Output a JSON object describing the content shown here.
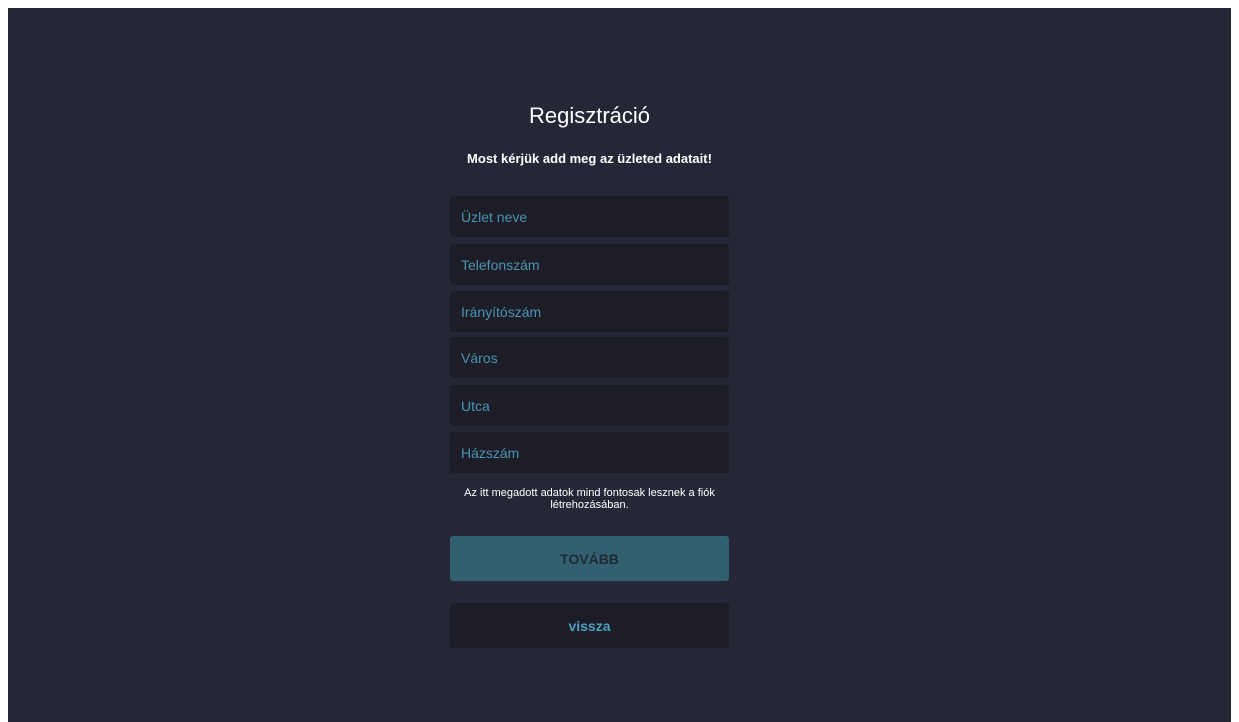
{
  "form": {
    "title": "Regisztráció",
    "subtitle": "Most kérjük add meg az üzleted adatait!",
    "fields": [
      {
        "placeholder": "Üzlet neve",
        "value": ""
      },
      {
        "placeholder": "Telefonszám",
        "value": ""
      },
      {
        "placeholder": "Irányítószám",
        "value": ""
      },
      {
        "placeholder": "Város",
        "value": ""
      },
      {
        "placeholder": "Utca",
        "value": ""
      },
      {
        "placeholder": "Házszám",
        "value": ""
      }
    ],
    "note": "Az itt megadott adatok mind fontosak lesznek a fiók létrehozásában.",
    "next_label": "TOVÁBB",
    "back_label": "vissza"
  },
  "colors": {
    "background": "#252736",
    "field_background": "#1c1d27",
    "placeholder": "#4a94b4",
    "primary_button": "#33606f",
    "text": "#ffffff"
  }
}
